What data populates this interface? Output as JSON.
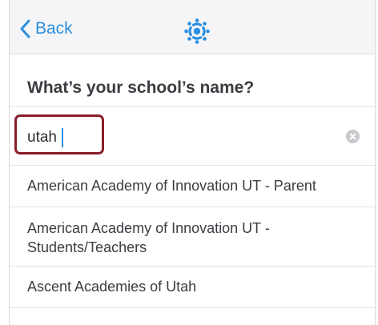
{
  "navbar": {
    "back_label": "Back",
    "back_icon": "chevron-left-icon",
    "logo_icon": "canvas-logo-icon",
    "accent_color": "#2b8ee0"
  },
  "header": {
    "title": "What’s your school’s name?"
  },
  "search": {
    "value": "utah",
    "clear_icon": "clear-circle-icon",
    "highlight_color": "#8a1d2b"
  },
  "results": [
    {
      "label": "American Academy of Innovation UT - Parent"
    },
    {
      "label": "American Academy of Innovation UT - Students/Teachers"
    },
    {
      "label": "Ascent Academies of Utah"
    }
  ]
}
